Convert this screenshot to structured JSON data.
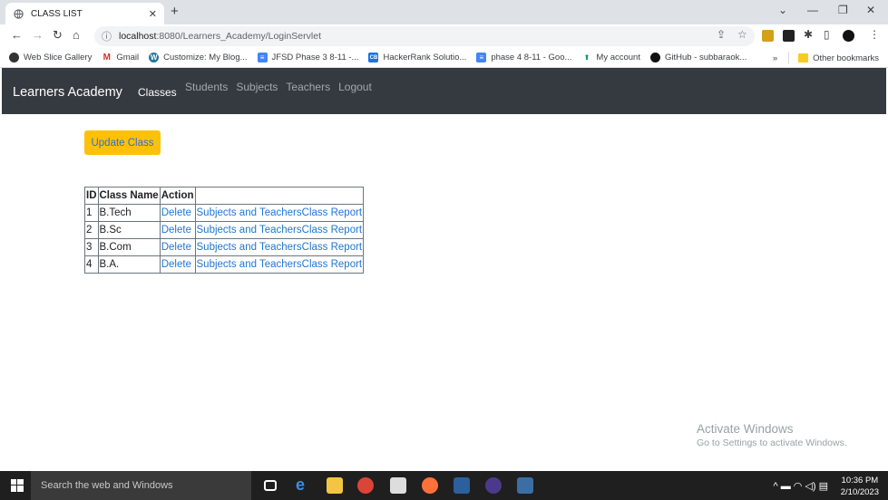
{
  "browser": {
    "tab_title": "CLASS LIST",
    "url_host": "localhost",
    "url_rest": ":8080/Learners_Academy/LoginServlet",
    "bookmarks": [
      {
        "label": "Web Slice Gallery",
        "icon": "web-slice-icon"
      },
      {
        "label": "Gmail",
        "icon": "gmail-icon"
      },
      {
        "label": "Customize: My Blog...",
        "icon": "wordpress-icon"
      },
      {
        "label": "JFSD Phase 3 8-11 -...",
        "icon": "docs-icon"
      },
      {
        "label": "HackerRank Solutio...",
        "icon": "hackerrank-icon"
      },
      {
        "label": "phase 4 8-11 - Goo...",
        "icon": "docs-icon"
      },
      {
        "label": "My account",
        "icon": "account-icon"
      },
      {
        "label": "GitHub - subbaraok...",
        "icon": "github-icon"
      }
    ],
    "other_bookmarks": "Other bookmarks"
  },
  "navbar": {
    "brand": "Learners Academy",
    "active": "Classes",
    "links": [
      "Students",
      "Subjects",
      "Teachers",
      "Logout"
    ]
  },
  "main": {
    "update_button": "Update Class",
    "table": {
      "headers": [
        "ID",
        "Class Name",
        "Action",
        ""
      ],
      "rows": [
        {
          "id": "1",
          "name": "B.Tech",
          "delete": "Delete",
          "subjects": "Subjects and Teachers",
          "report": "Class Report"
        },
        {
          "id": "2",
          "name": "B.Sc",
          "delete": "Delete",
          "subjects": "Subjects and Teachers",
          "report": "Class Report"
        },
        {
          "id": "3",
          "name": "B.Com",
          "delete": "Delete",
          "subjects": "Subjects and Teachers",
          "report": "Class Report"
        },
        {
          "id": "4",
          "name": "B.A.",
          "delete": "Delete",
          "subjects": "Subjects and Teachers",
          "report": "Class Report"
        }
      ]
    }
  },
  "watermark": {
    "line1": "Activate Windows",
    "line2": "Go to Settings to activate Windows."
  },
  "taskbar": {
    "search_placeholder": "Search the web and Windows",
    "time": "10:36 PM",
    "date": "2/10/2023"
  },
  "colors": {
    "navbar_bg": "#343a40",
    "button_bg": "#ffc107",
    "link": "#2176d2"
  }
}
